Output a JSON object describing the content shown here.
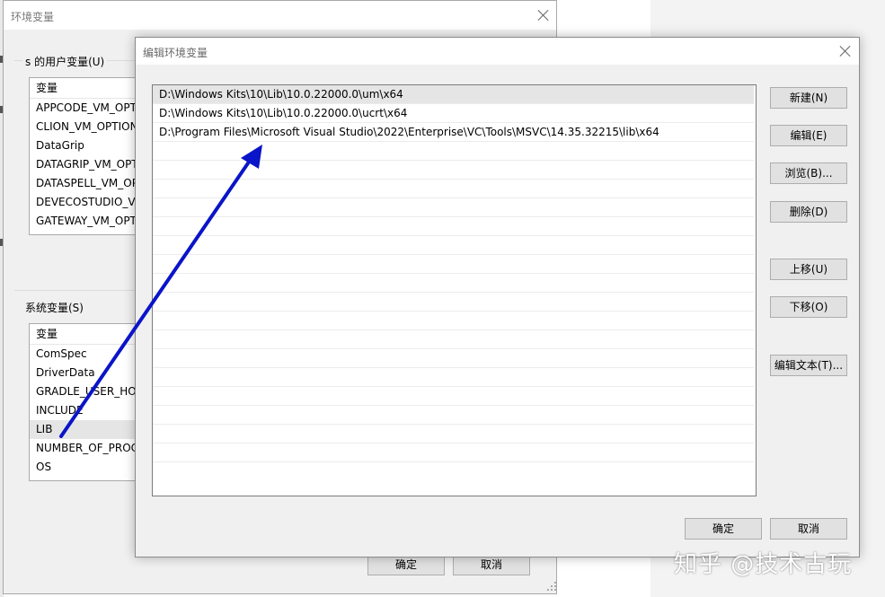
{
  "env_dialog": {
    "title": "环境变量",
    "user_section_label": "s 的用户变量(U)",
    "system_section_label": "系统变量(S)",
    "user_vars": {
      "header": "变量",
      "rows": [
        "APPCODE_VM_OPTIONS",
        "CLION_VM_OPTIONS",
        "DataGrip",
        "DATAGRIP_VM_OPTIONS",
        "DATASPELL_VM_OPTIONS",
        "DEVECOSTUDIO_VM_OPTIONS",
        "GATEWAY_VM_OPTIONS"
      ]
    },
    "system_vars": {
      "header": "变量",
      "rows": [
        "ComSpec",
        "DriverData",
        "GRADLE_USER_HOME",
        "INCLUDE",
        "LIB",
        "NUMBER_OF_PROCESSORS",
        "OS"
      ],
      "selected": "LIB"
    },
    "ok_label": "确定",
    "cancel_label": "取消"
  },
  "edit_dialog": {
    "title": "编辑环境变量",
    "paths": [
      "D:\\Windows Kits\\10\\Lib\\10.0.22000.0\\um\\x64",
      "D:\\Windows Kits\\10\\Lib\\10.0.22000.0\\ucrt\\x64",
      "D:\\Program Files\\Microsoft Visual Studio\\2022\\Enterprise\\VC\\Tools\\MSVC\\14.35.32215\\lib\\x64"
    ],
    "selected_path_index": 0,
    "buttons": {
      "new": "新建(N)",
      "edit": "编辑(E)",
      "browse": "浏览(B)...",
      "delete": "删除(D)",
      "move_up": "上移(U)",
      "move_down": "下移(O)",
      "edit_text": "编辑文本(T)...",
      "ok": "确定",
      "cancel": "取消"
    }
  },
  "annotation": {
    "arrow_color": "#0a14c8"
  },
  "watermark": "知乎 @技术古玩"
}
